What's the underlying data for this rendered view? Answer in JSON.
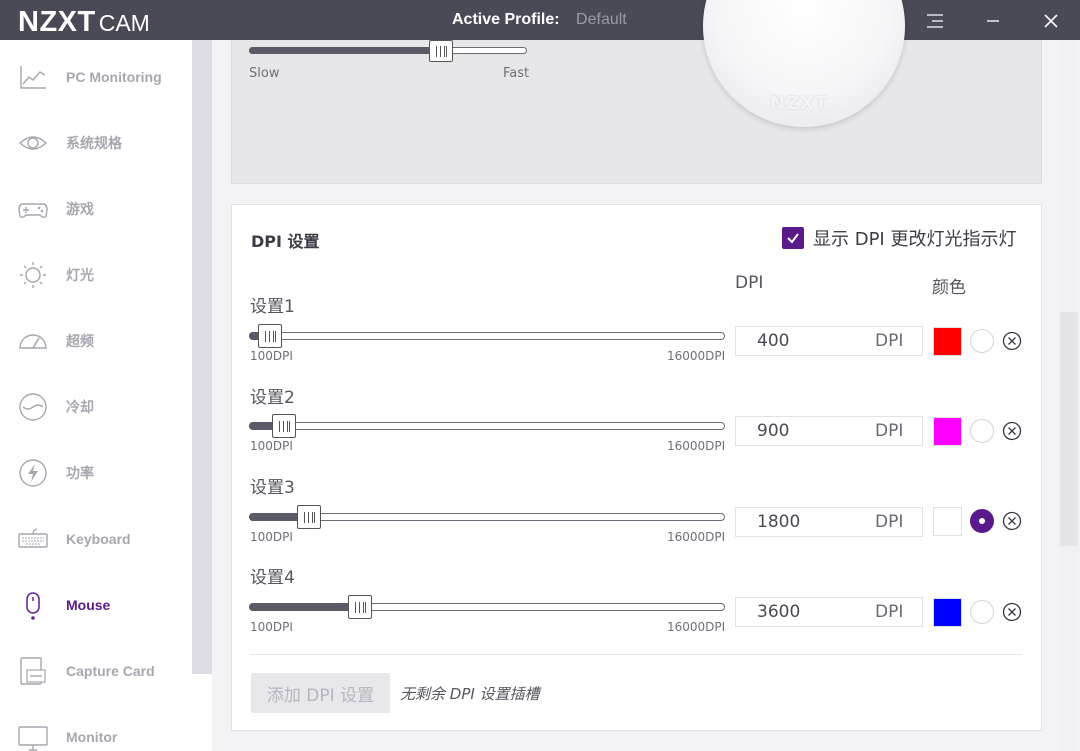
{
  "app": {
    "brand": "NZXT",
    "product": "CAM",
    "profile_label": "Active Profile:",
    "profile_value": "Default"
  },
  "sidebar": {
    "items": [
      {
        "label": "PC Monitoring",
        "icon": "chart-line-icon"
      },
      {
        "label": "系统规格",
        "icon": "eye-icon"
      },
      {
        "label": "游戏",
        "icon": "gamepad-icon"
      },
      {
        "label": "灯光",
        "icon": "sun-icon"
      },
      {
        "label": "超频",
        "icon": "gauge-icon"
      },
      {
        "label": "冷却",
        "icon": "cooling-icon"
      },
      {
        "label": "功率",
        "icon": "bolt-icon"
      },
      {
        "label": "Keyboard",
        "icon": "keyboard-icon"
      },
      {
        "label": "Mouse",
        "icon": "mouse-icon",
        "active": true
      },
      {
        "label": "Capture Card",
        "icon": "capture-card-icon"
      },
      {
        "label": "Monitor",
        "icon": "monitor-icon"
      }
    ]
  },
  "lighting": {
    "speed_min_label": "Slow",
    "speed_max_label": "Fast",
    "speed_level": 0.69,
    "device_logo": "NZXT"
  },
  "dpi": {
    "title": "DPI 设置",
    "show_indicator_label": "显示 DPI 更改灯光指示灯",
    "show_indicator_checked": true,
    "col_dpi": "DPI",
    "col_color": "颜色",
    "range_min": "100DPI",
    "range_max": "16000DPI",
    "unit": "DPI",
    "rows": [
      {
        "label": "设置1",
        "value": "400",
        "color": "#ff0000",
        "selected": false,
        "level": 400
      },
      {
        "label": "设置2",
        "value": "900",
        "color": "#ff00ff",
        "selected": false,
        "level": 900
      },
      {
        "label": "设置3",
        "value": "1800",
        "color": "#ffffff",
        "selected": true,
        "level": 1800
      },
      {
        "label": "设置4",
        "value": "3600",
        "color": "#0000ff",
        "selected": false,
        "level": 3600
      }
    ],
    "add_button": "添加 DPI 设置",
    "no_slot_text": "无剩余 DPI 设置插槽"
  },
  "colors": {
    "accent": "#5a1a8a",
    "titlebar": "#4a4a57"
  }
}
